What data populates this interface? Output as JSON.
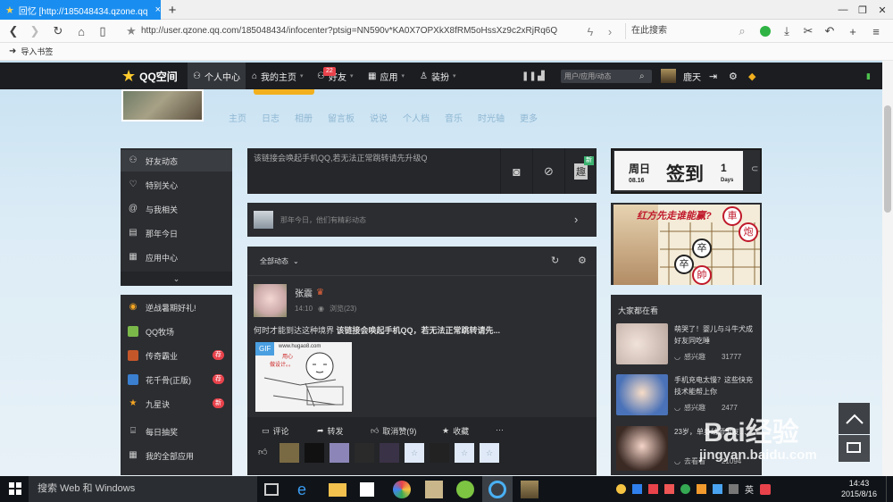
{
  "browser": {
    "tab_title": "回忆 [http://185048434.qzone.qq",
    "tab_close": "×",
    "new_tab": "+",
    "url": "http://user.qzone.qq.com/185048434/infocenter?ptsig=NN590v*KA0X7OPXkX8fRM5oHssXz9c2xRjRq6Q",
    "search_placeholder": "在此搜索",
    "bookmark_label": "导入书签"
  },
  "qzone_nav": {
    "logo": "QQ空间",
    "personal_center": "个人中心",
    "my_home": "我的主页",
    "friends": "好友",
    "friends_badge": "22",
    "apps": "应用",
    "dressup": "装扮",
    "search_placeholder": "用户/应用/动态",
    "username": "鹿天"
  },
  "profile_nav": [
    "主页",
    "日志",
    "相册",
    "留言板",
    "说说",
    "个人档",
    "音乐",
    "时光轴",
    "更多"
  ],
  "left_menu_1": [
    {
      "label": "好友动态",
      "icon": "user-icon"
    },
    {
      "label": "特别关心",
      "icon": "heart-icon"
    },
    {
      "label": "与我相关",
      "icon": "at-icon"
    },
    {
      "label": "那年今日",
      "icon": "calendar-icon"
    },
    {
      "label": "应用中心",
      "icon": "grid-icon"
    }
  ],
  "left_menu_2": [
    {
      "label": "逆战暑期好礼!",
      "icon": "speaker-icon",
      "badge": ""
    },
    {
      "label": "QQ牧场",
      "icon": "farm-icon",
      "badge": ""
    },
    {
      "label": "传奇霸业",
      "icon": "game-icon",
      "badge": "荐"
    },
    {
      "label": "花千骨(正版)",
      "icon": "flower-icon",
      "badge": "荐"
    },
    {
      "label": "九星诀",
      "icon": "star-icon",
      "badge": "新"
    },
    {
      "label": "每日抽奖",
      "icon": "gift-icon",
      "badge": ""
    },
    {
      "label": "我的全部应用",
      "icon": "grid-icon",
      "badge": ""
    }
  ],
  "post_box": {
    "placeholder": "该链接会唤起手机QQ,若无法正常跳转请先升级Q",
    "new_badge": "新",
    "fun_label": "趣"
  },
  "on_this_day": "那年今日，他们有精彩动态",
  "feed": {
    "filter_label": "全部动态",
    "author": "张震",
    "time": "14:10",
    "views": "浏览(23)",
    "text_prefix": "何时才能到达这种境界 ",
    "text_bold": "该链接会唤起手机QQ，若无法正常跳转请先...",
    "gif_label": "GIF",
    "gif_caption_1": "www.hugao8.com",
    "gif_caption_2": "用心",
    "gif_caption_3": "做设计。。",
    "actions": [
      "评论",
      "转发",
      "取消赞(9)",
      "收藏",
      "···"
    ]
  },
  "signin": {
    "weekday": "周日",
    "date": "08.16",
    "label": "签到",
    "days_num": "1",
    "days_label": "Days"
  },
  "chess_ad": {
    "title": "红方先走谁能赢?",
    "pieces": [
      "車",
      "炮",
      "卒",
      "卒",
      "帥"
    ]
  },
  "hot": {
    "title": "大家都在看",
    "items": [
      {
        "text": "萌哭了！婴儿与斗牛犬成好友同吃睡",
        "tag": "感兴趣",
        "count": "31777"
      },
      {
        "text": "手机充电太慢？这些快充技术能帮上你",
        "tag": "感兴趣",
        "count": "2477"
      },
      {
        "text": "23岁，单身幼师男友…",
        "tag": "去看看",
        "count": "21094"
      }
    ]
  },
  "taskbar": {
    "search": "搜索 Web 和 Windows",
    "ime": "英",
    "time": "14:43",
    "date": "2015/8/16"
  },
  "watermark": {
    "text": "Bai经验",
    "url": "jingyan.baidu.com"
  },
  "colors": {
    "tab_blue": "#1a8ef0",
    "panel_dark": "#2b2d31",
    "badge_red": "#e8424b",
    "qzone_bar": "#1b1d21"
  }
}
